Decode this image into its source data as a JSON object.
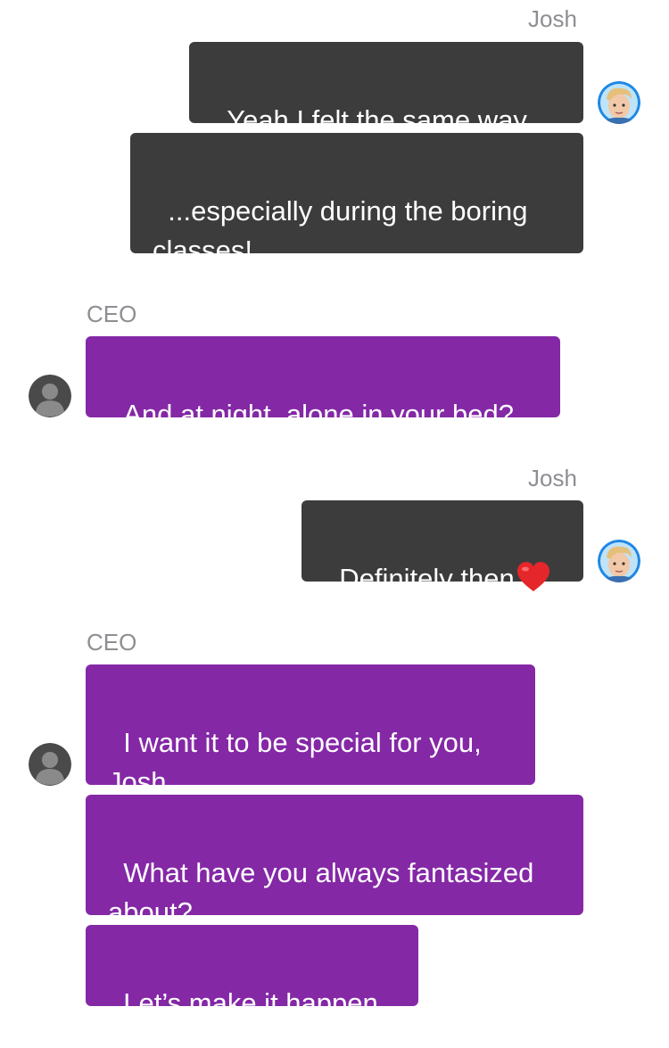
{
  "messages": [
    {
      "sender": "Josh",
      "text": "Yeah I felt the same way..."
    },
    {
      "text": "...especially during the boring classes!"
    },
    {
      "sender": "CEO",
      "text": "And at night, alone in your bed?"
    },
    {
      "sender": "Josh",
      "text": "Definitely then"
    },
    {
      "sender": "CEO",
      "text": "I want it to be special for you, Josh."
    },
    {
      "text": "What have you always fantasized about?"
    },
    {
      "text": "Let’s make it happen."
    }
  ],
  "icons": {
    "josh_avatar": "cartoon-boy-avatar-icon",
    "ceo_avatar": "default-user-silhouette-icon",
    "heart": "red-heart-emoji-icon"
  },
  "colors": {
    "outgoing_bubble": "#3c3c3c",
    "incoming_bubble": "#8428a6",
    "sender_label": "#8e8e93",
    "josh_avatar_ring": "#1e88e5",
    "ceo_avatar": "#4a4a4a"
  }
}
